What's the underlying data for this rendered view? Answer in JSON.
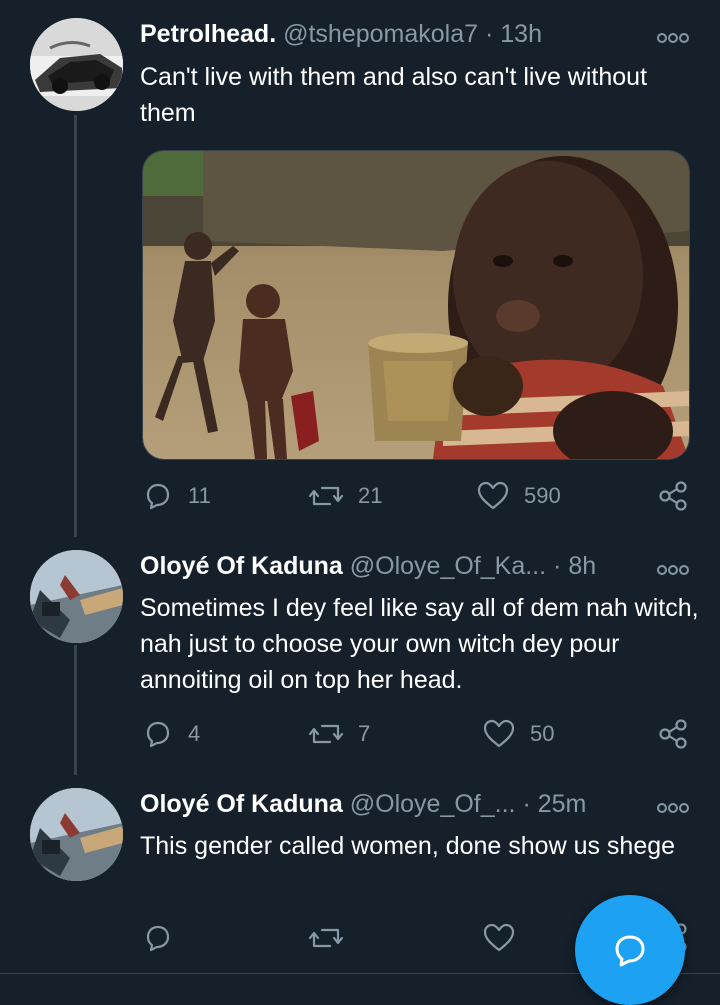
{
  "tweets": [
    {
      "name": "Petrolhead.",
      "handle": "@tshepomakola7",
      "time": "13h",
      "text": "Can't live with them and also can't live without them",
      "replies": "11",
      "retweets": "21",
      "likes": "590",
      "avatar_icon": "profile-photo"
    },
    {
      "name": "Oloyé Of Kaduna",
      "handle": "@Oloye_Of_Ka...",
      "time": "8h",
      "text": "Sometimes I dey feel like say all of dem nah witch, nah just to choose your own witch dey pour annoiting oil on top her head.",
      "replies": "4",
      "retweets": "7",
      "likes": "50",
      "avatar_icon": "profile-photo"
    },
    {
      "name": "Oloyé Of Kaduna",
      "handle": "@Oloye_Of_...",
      "time": "25m",
      "text": "This gender called women, done show us shege",
      "replies": "",
      "retweets": "",
      "likes": "",
      "avatar_icon": "profile-photo"
    }
  ],
  "separator": "·",
  "icons": {
    "reply": "reply-icon",
    "retweet": "retweet-icon",
    "like": "heart-icon",
    "share": "share-icon",
    "more": "more-icon",
    "compose": "compose-reply-icon"
  },
  "colors": {
    "background": "#15202b",
    "secondary_text": "#8899a6",
    "accent": "#1da1f2",
    "border": "#38444d"
  }
}
